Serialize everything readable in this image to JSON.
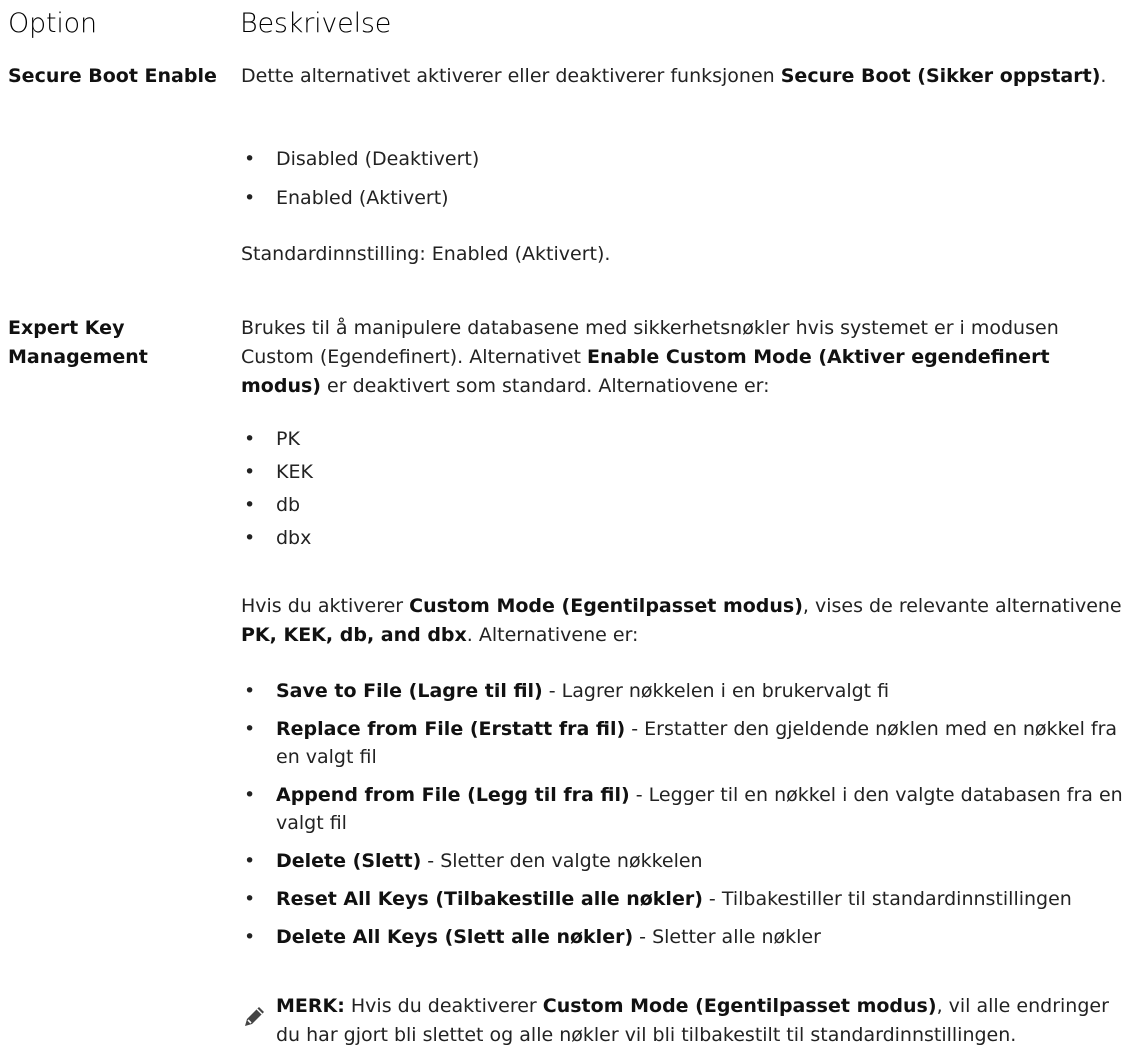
{
  "headers": {
    "option": "Option",
    "description": "Beskrivelse"
  },
  "secure_boot": {
    "label": "Secure Boot Enable",
    "desc_pre": "Dette alternativet aktiverer eller deaktiverer funksjonen ",
    "desc_bold": "Secure Boot (Sikker oppstart)",
    "desc_post": ".",
    "options": [
      "Disabled (Deaktivert)",
      "Enabled (Aktivert)"
    ],
    "default": "Standardinnstilling: Enabled (Aktivert)."
  },
  "expert_key": {
    "label": "Expert Key Management",
    "desc_pre": "Brukes til å manipulere databasene med sikkerhetsnøkler hvis systemet er i modusen Custom (Egendefinert). Alternativet ",
    "desc_bold": "Enable Custom Mode (Aktiver egendefinert modus)",
    "desc_post": " er deaktivert som standard. Alternatiovene er:",
    "keys": [
      "PK",
      "KEK",
      "db",
      "dbx"
    ],
    "custom_pre": "Hvis du aktiverer ",
    "custom_bold1": "Custom Mode (Egentilpasset modus)",
    "custom_mid": ", vises de relevante alternativene ",
    "custom_bold2": "PK, KEK, db, and dbx",
    "custom_post": ". Alternativene er:",
    "actions": [
      {
        "name": "Save to File (Lagre til fil)",
        "text": " - Lagrer nøkkelen i en brukervalgt fi"
      },
      {
        "name": "Replace from File (Erstatt fra fil)",
        "text": " - Erstatter den gjeldende nøklen med en nøkkel fra en valgt fil"
      },
      {
        "name": "Append from File (Legg til fra fil)",
        "text": " - Legger til en nøkkel i den valgte databasen fra en valgt fil"
      },
      {
        "name": "Delete (Slett)",
        "text": " - Sletter den valgte nøkkelen"
      },
      {
        "name": "Reset All Keys (Tilbakestille alle nøkler)",
        "text": " - Tilbakestiller til standardinnstillingen"
      },
      {
        "name": "Delete All Keys (Slett alle nøkler)",
        "text": " - Sletter alle nøkler"
      }
    ],
    "note_label": "MERK:",
    "note_pre": " Hvis du deaktiverer ",
    "note_bold": "Custom Mode (Egentilpasset modus)",
    "note_post": ", vil alle endringer du har gjort bli slettet og alle nøkler vil bli tilbakestilt til standardinnstillingen.",
    "note_icon": "pencil-note-icon"
  }
}
